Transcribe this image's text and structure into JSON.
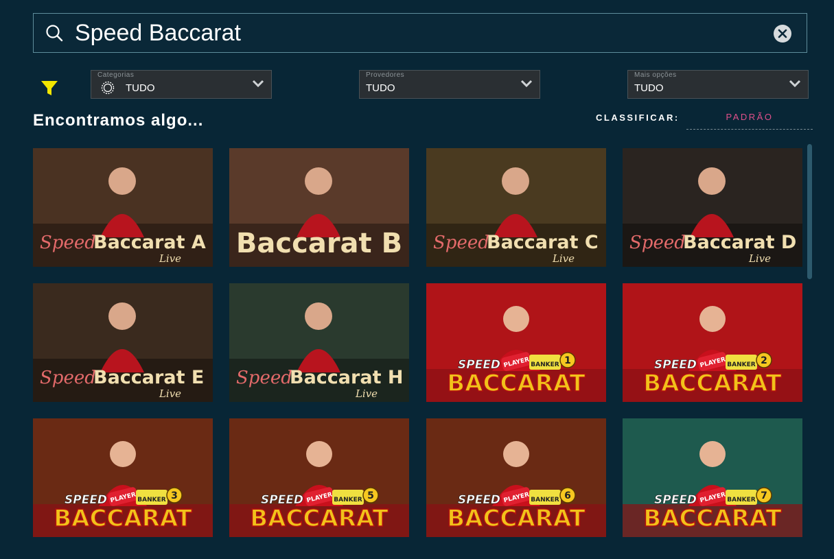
{
  "search": {
    "query": "Speed Baccarat"
  },
  "filters": {
    "categories": {
      "label": "Categorias",
      "value": "TUDO"
    },
    "providers": {
      "label": "Provedores",
      "value": "TUDO"
    },
    "more": {
      "label": "Mais opções",
      "value": "TUDO"
    }
  },
  "results": {
    "heading": "Encontramos algo..."
  },
  "sort": {
    "label": "CLASSIFICAR:",
    "value": "PADRÃO"
  },
  "games": [
    {
      "style": "a",
      "prefix": "Speed",
      "title": "Baccarat",
      "letter": "A",
      "sub": "Live"
    },
    {
      "style": "a",
      "prefix": "",
      "title": "Baccarat",
      "letter": "B",
      "sub": ""
    },
    {
      "style": "a",
      "prefix": "Speed",
      "title": "Baccarat",
      "letter": "C",
      "sub": "Live"
    },
    {
      "style": "a",
      "prefix": "Speed",
      "title": "Baccarat",
      "letter": "D",
      "sub": "Live"
    },
    {
      "style": "a",
      "prefix": "Speed",
      "title": "Baccarat",
      "letter": "E",
      "sub": "Live"
    },
    {
      "style": "a",
      "prefix": "Speed",
      "title": "Baccarat",
      "letter": "H",
      "sub": "Live"
    },
    {
      "style": "b",
      "speed": "SPEED",
      "title": "BACCARAT",
      "player": "PLAYER",
      "banker": "BANKER",
      "num": "1"
    },
    {
      "style": "b",
      "speed": "SPEED",
      "title": "BACCARAT",
      "player": "PLAYER",
      "banker": "BANKER",
      "num": "2"
    },
    {
      "style": "b",
      "speed": "SPEED",
      "title": "BACCARAT",
      "player": "PLAYER",
      "banker": "BANKER",
      "num": "3"
    },
    {
      "style": "b",
      "speed": "SPEED",
      "title": "BACCARAT",
      "player": "PLAYER",
      "banker": "BANKER",
      "num": "5"
    },
    {
      "style": "b",
      "speed": "SPEED",
      "title": "BACCARAT",
      "player": "PLAYER",
      "banker": "BANKER",
      "num": "6"
    },
    {
      "style": "b",
      "speed": "SPEED",
      "title": "BACCARAT",
      "player": "PLAYER",
      "banker": "BANKER",
      "num": "7"
    }
  ],
  "colors": {
    "background": "#082636",
    "accent_sort": "#e0508a",
    "filter_icon": "#f2e600"
  },
  "icons": {
    "search": "search-icon",
    "clear": "clear-icon",
    "filter": "funnel-icon",
    "chevron": "chevron-down-icon",
    "category": "chip-icon"
  }
}
